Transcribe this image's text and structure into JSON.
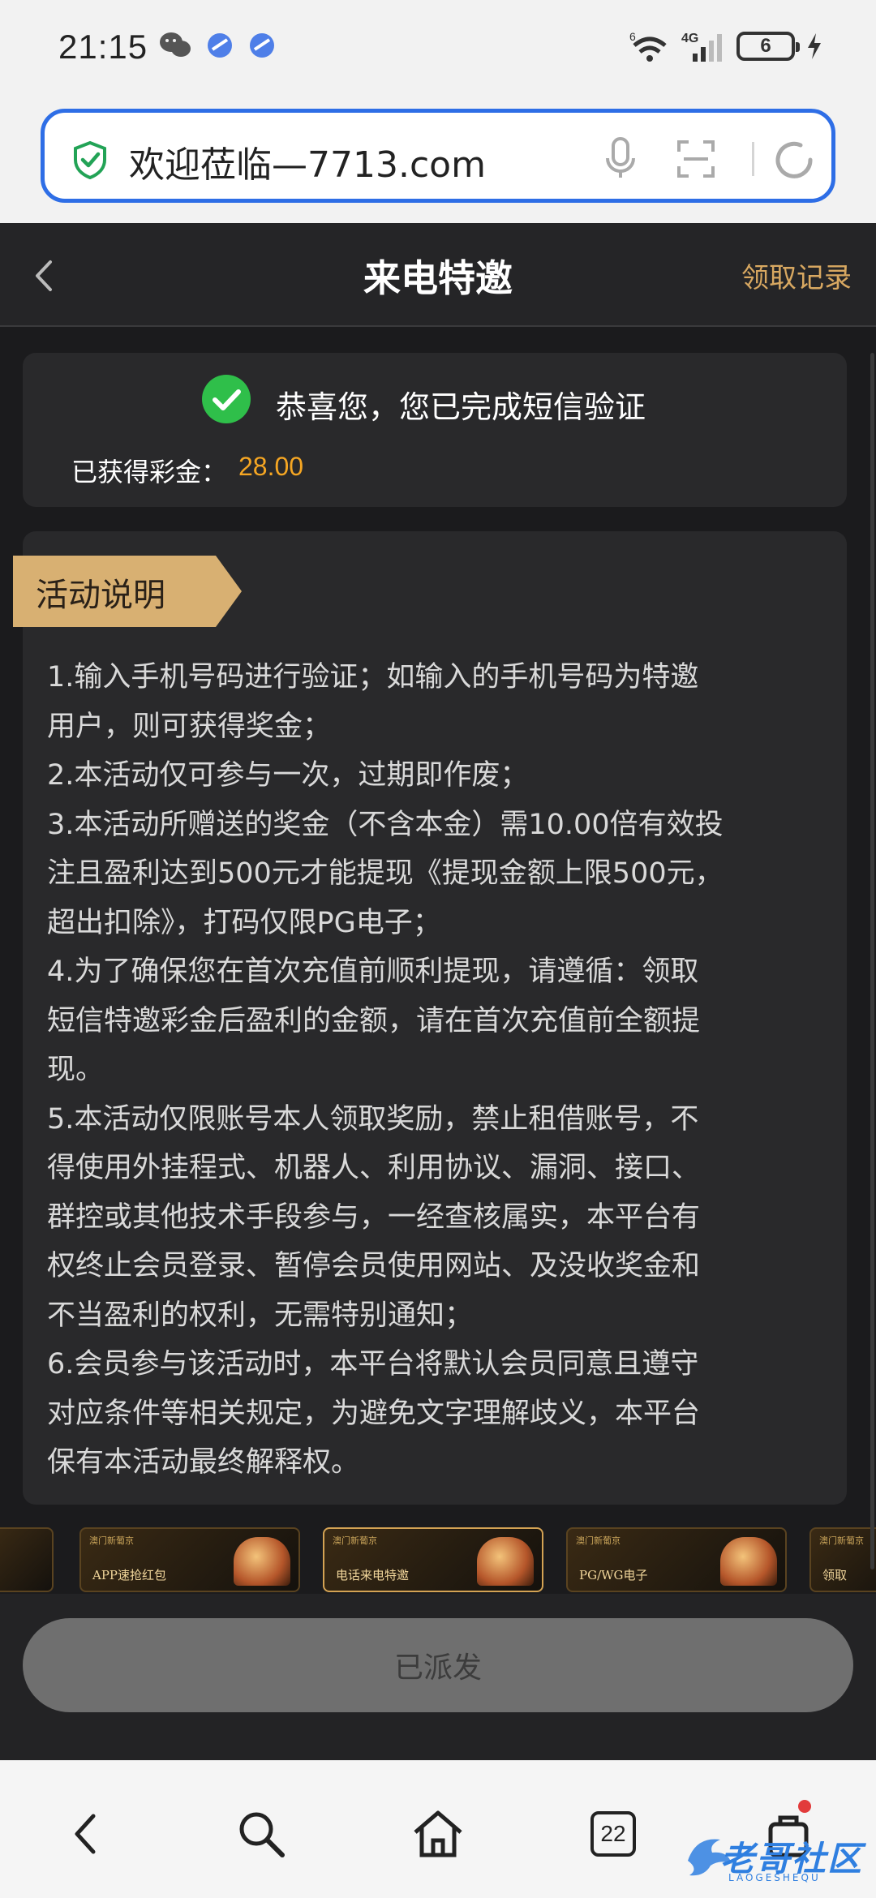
{
  "status_bar": {
    "time": "21:15",
    "network": "4G",
    "wifi_badge": "6",
    "battery": "6"
  },
  "url_bar": {
    "url": "欢迎莅临—7713.com"
  },
  "header": {
    "title": "来电特邀",
    "right_link": "领取记录"
  },
  "verify": {
    "message": "恭喜您，您已完成短信验证",
    "bonus_label": "已获得彩金：",
    "bonus_value": "28.00"
  },
  "rules": {
    "tag": "活动说明",
    "lines": [
      "1.输入手机号码进行验证；如输入的手机号码为特邀",
      "用户，则可获得奖金；",
      "2.本活动仅可参与一次，过期即作废；",
      "3.本活动所赠送的奖金（不含本金）需10.00倍有效投",
      "注且盈利达到500元才能提现《提现金额上限500元，",
      "超出扣除》，打码仅限PG电子；",
      "4.为了确保您在首次充值前顺利提现，请遵循：领取",
      "短信特邀彩金后盈利的金额，请在首次充值前全额提",
      "现。",
      "5.本活动仅限账号本人领取奖励，禁止租借账号，不",
      "得使用外挂程式、机器人、利用协议、漏洞、接口、",
      "群控或其他技术手段参与，一经查核属实，本平台有",
      "权终止会员登录、暂停会员使用网站、及没收奖金和",
      "不当盈利的权利，无需特别通知；",
      "6.会员参与该活动时，本平台将默认会员同意且遵守",
      "对应条件等相关规定，为避免文字理解歧义，本平台",
      "保有本活动最终解释权。"
    ]
  },
  "banners": [
    {
      "brand": "澳门新葡京",
      "title": "APP速抢红包"
    },
    {
      "brand": "澳门新葡京",
      "title": "电话来电特邀"
    },
    {
      "brand": "澳门新葡京",
      "title": "PG/WG电子"
    },
    {
      "brand": "澳门新葡京",
      "title": "领取"
    }
  ],
  "dispatch_button": "已派发",
  "bottom_nav": {
    "tabs_count": "22"
  },
  "watermark": {
    "text": "老哥社区",
    "sub": "LAOGESHEQU"
  },
  "colors": {
    "accent_gold": "#d8a861",
    "bonus_orange": "#f5a623",
    "url_border": "#2e6ee6",
    "check_green": "#2fbf4a"
  }
}
